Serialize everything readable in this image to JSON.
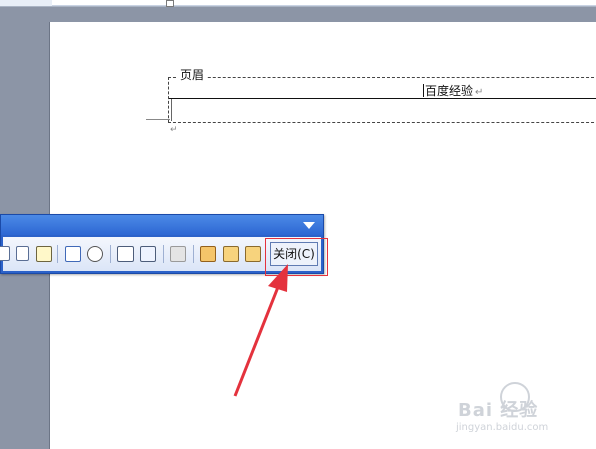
{
  "document": {
    "header_label": "页眉",
    "header_text": "百度经验",
    "header_return_mark": "↵",
    "body_paragraph_mark": "↵"
  },
  "toolbar": {
    "close_button_label": "关闭(C)",
    "icons": [
      "page-icon",
      "insert-page-number-icon",
      "format-page-number-icon",
      "insert-date-icon",
      "insert-time-icon",
      "page-setup-icon",
      "show-hide-document-text-icon",
      "same-as-previous-icon",
      "switch-header-footer-icon",
      "show-previous-icon",
      "show-next-icon"
    ]
  },
  "annotation": {
    "highlight_color": "#e4323d",
    "arrow_color": "#e4323d"
  },
  "watermark": {
    "brand": "Bai 经验",
    "url": "jingyan.baidu.com"
  }
}
